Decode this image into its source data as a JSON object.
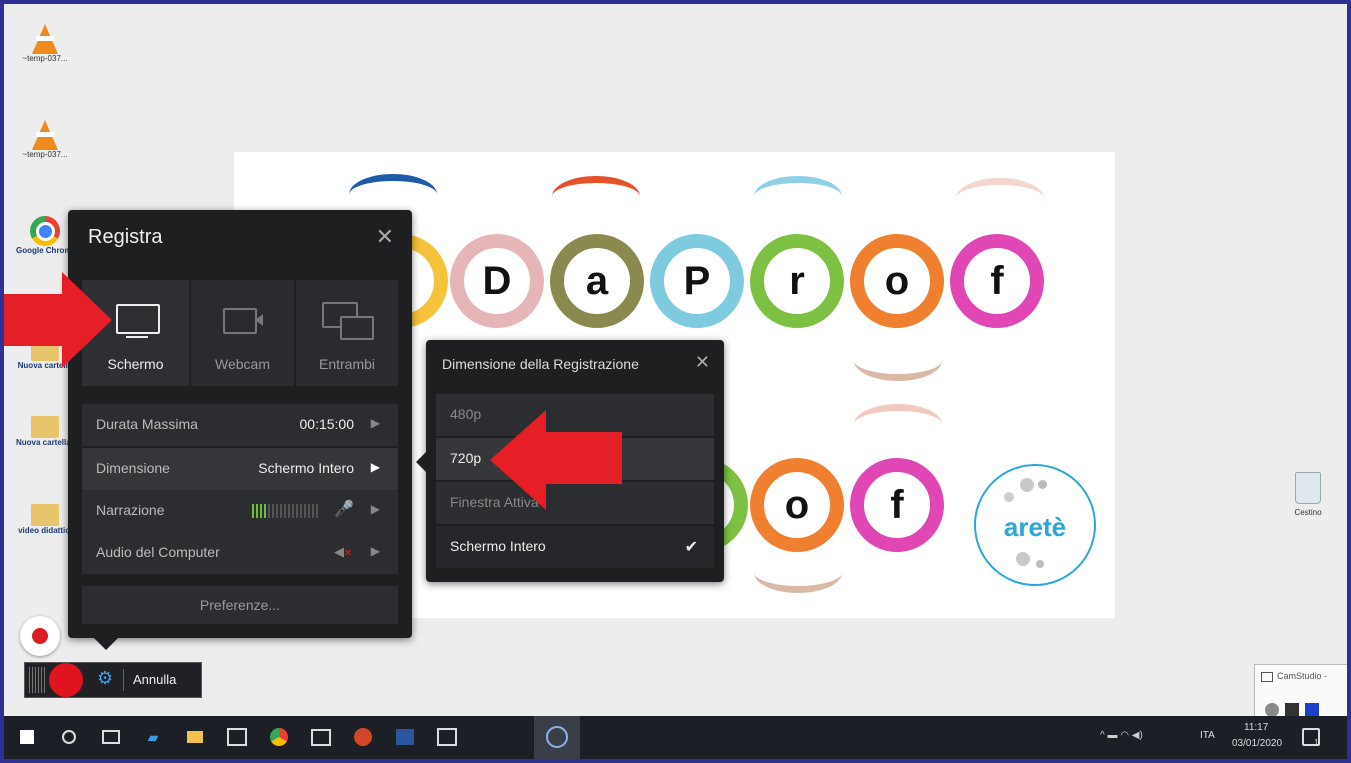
{
  "desktop": {
    "icons": [
      {
        "label": "~temp-037..."
      },
      {
        "label": "~temp-037..."
      },
      {
        "label": "Google Chrome"
      },
      {
        "label": "Nuova cartella"
      },
      {
        "label": "Nuova cartella (1)"
      },
      {
        "label": "video didattici"
      }
    ],
    "recycle_label": "Cestino",
    "camstudio_label": "CamStudio -"
  },
  "slide": {
    "row1_letters": [
      "D",
      "a",
      "P",
      "r",
      "o",
      "f"
    ],
    "row2_letters": [
      "o",
      "f"
    ],
    "logo_text": "aretè"
  },
  "colors": {
    "ring_olive": "#8a8a4e",
    "ring_pink": "#e5b5b8",
    "ring_cyan": "#7ecbe0",
    "ring_green": "#7dc142",
    "ring_orange": "#f07f2f",
    "ring_magenta": "#e046b4",
    "ring_yellow": "#f7c23b",
    "arrow_red": "#e61e26",
    "frame_border": "#2e3192",
    "accent_blue": "#3aa0e6"
  },
  "record_panel": {
    "title": "Registra",
    "sources": [
      {
        "label": "Schermo",
        "icon": "monitor-icon",
        "active": true
      },
      {
        "label": "Webcam",
        "icon": "webcam-icon",
        "active": false
      },
      {
        "label": "Entrambi",
        "icon": "dual-screen-icon",
        "active": false
      }
    ],
    "settings": {
      "max_duration_label": "Durata Massima",
      "max_duration_value": "00:15:00",
      "dimension_label": "Dimensione",
      "dimension_value": "Schermo Intero",
      "narration_label": "Narrazione",
      "computer_audio_label": "Audio del Computer"
    },
    "preferences_label": "Preferenze..."
  },
  "dimension_menu": {
    "title": "Dimensione della Registrazione",
    "options": [
      {
        "label": "480p",
        "selected": false
      },
      {
        "label": "720p",
        "selected": false
      },
      {
        "label": "Finestra Attiva",
        "selected": false
      },
      {
        "label": "Schermo Intero",
        "selected": true
      }
    ]
  },
  "recorder_bar": {
    "cancel_label": "Annulla"
  },
  "taskbar": {
    "time": "11:17",
    "date": "03/01/2020",
    "language": "ITA",
    "notification_count": "1"
  }
}
